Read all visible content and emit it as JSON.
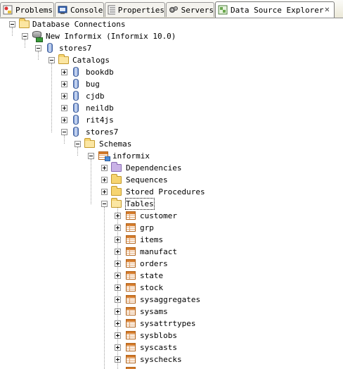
{
  "tabs": [
    {
      "label": "Problems",
      "icon": "problems-icon"
    },
    {
      "label": "Console",
      "icon": "console-icon"
    },
    {
      "label": "Properties",
      "icon": "properties-icon"
    },
    {
      "label": "Servers",
      "icon": "servers-icon"
    },
    {
      "label": "Data Source Explorer",
      "icon": "data-source-explorer-icon",
      "active": true,
      "close": "✕"
    }
  ],
  "tree": {
    "root": "Database Connections",
    "connection": "New Informix (Informix 10.0)",
    "database": "stores7",
    "catalogs_folder": "Catalogs",
    "catalogs": [
      "bookdb",
      "bug",
      "cjdb",
      "neildb",
      "rit4js",
      "stores7"
    ],
    "schemas_folder": "Schemas",
    "schema": "informix",
    "schema_children": [
      "Dependencies",
      "Sequences",
      "Stored Procedures",
      "Tables"
    ],
    "tables": [
      "customer",
      "grp",
      "items",
      "manufact",
      "orders",
      "state",
      "stock",
      "sysaggregates",
      "sysams",
      "sysattrtypes",
      "sysblobs",
      "syscasts",
      "syschecks"
    ]
  },
  "colors": {
    "folder": "#f6d470",
    "dependencies_folder": "#c9b2e6",
    "table_icon": "#d57b2a",
    "database_icon": "#6d8fcf"
  }
}
